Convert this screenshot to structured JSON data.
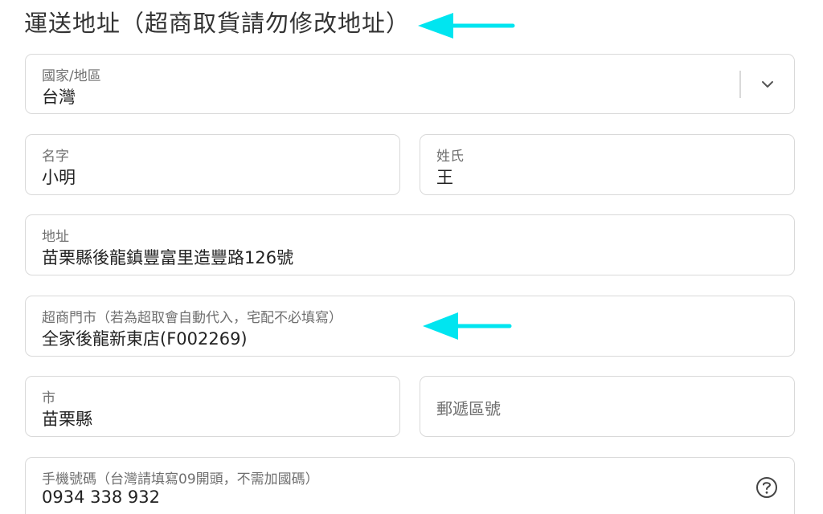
{
  "section": {
    "title": "運送地址（超商取貨請勿修改地址）"
  },
  "form": {
    "country": {
      "label": "國家/地區",
      "value": "台灣",
      "icon": "chevron-down-icon"
    },
    "first_name": {
      "label": "名字",
      "value": "小明"
    },
    "last_name": {
      "label": "姓氏",
      "value": "王"
    },
    "address": {
      "label": "地址",
      "value": "苗栗縣後龍鎮豐富里造豐路126號"
    },
    "store": {
      "label": "超商門市（若為超取會自動代入，宅配不必填寫）",
      "value": "全家後龍新東店(F002269)"
    },
    "city": {
      "label": "市",
      "value": "苗栗縣"
    },
    "postal_code": {
      "placeholder": "郵遞區號"
    },
    "phone": {
      "label": "手機號碼（台灣請填寫09開頭，不需加國碼）",
      "value": "0934 338 932",
      "icon": "help-circle-icon"
    }
  },
  "annotations": {
    "arrow_color": "#00e5f0",
    "arrow_count": 2
  }
}
